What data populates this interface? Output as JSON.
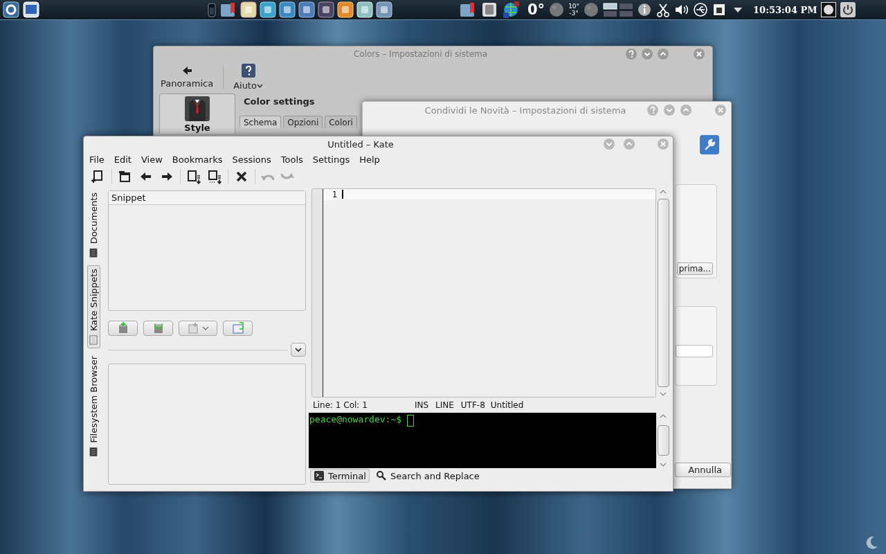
{
  "panel": {
    "temperature": "0°",
    "forecast_high": "10°",
    "forecast_low": "-3°",
    "clock": "10:53:04 PM"
  },
  "colors_window": {
    "title": "Colors – Impostazioni di sistema",
    "toolbar": [
      {
        "label": "Panoramica",
        "kind": "back"
      },
      {
        "label": "Aiuto",
        "kind": "help"
      }
    ],
    "sidebar": [
      {
        "label": "Style",
        "selected": true
      }
    ],
    "heading": "Color settings",
    "tabs": [
      {
        "label": "Schema",
        "selected": true
      },
      {
        "label": "Opzioni",
        "selected": false
      },
      {
        "label": "Colori",
        "selected": false
      }
    ]
  },
  "share_window": {
    "title": "Condividi le Novità – Impostazioni di sistema",
    "button": "prima...",
    "cancel_button": "Annulla"
  },
  "kate": {
    "title": "Untitled – Kate",
    "menu": [
      "File",
      "Edit",
      "View",
      "Bookmarks",
      "Sessions",
      "Tools",
      "Settings",
      "Help"
    ],
    "side_tabs": [
      {
        "label": "Documents",
        "selected": false
      },
      {
        "label": "Kate Snippets",
        "selected": true
      },
      {
        "label": "Filesystem Browser",
        "selected": false
      }
    ],
    "snippets": {
      "column": "Snippet"
    },
    "editor": {
      "line_numbers": [
        "1"
      ]
    },
    "status": [
      "Line: 1 Col: 1",
      "INS",
      "LINE",
      "UTF-8",
      "Untitled"
    ],
    "terminal": {
      "prompt": "peace@nowardev:~$"
    },
    "bottom_tabs": [
      {
        "label": "Terminal",
        "kind": "terminal",
        "selected": true
      },
      {
        "label": "Search and Replace",
        "kind": "search",
        "selected": false
      }
    ]
  }
}
